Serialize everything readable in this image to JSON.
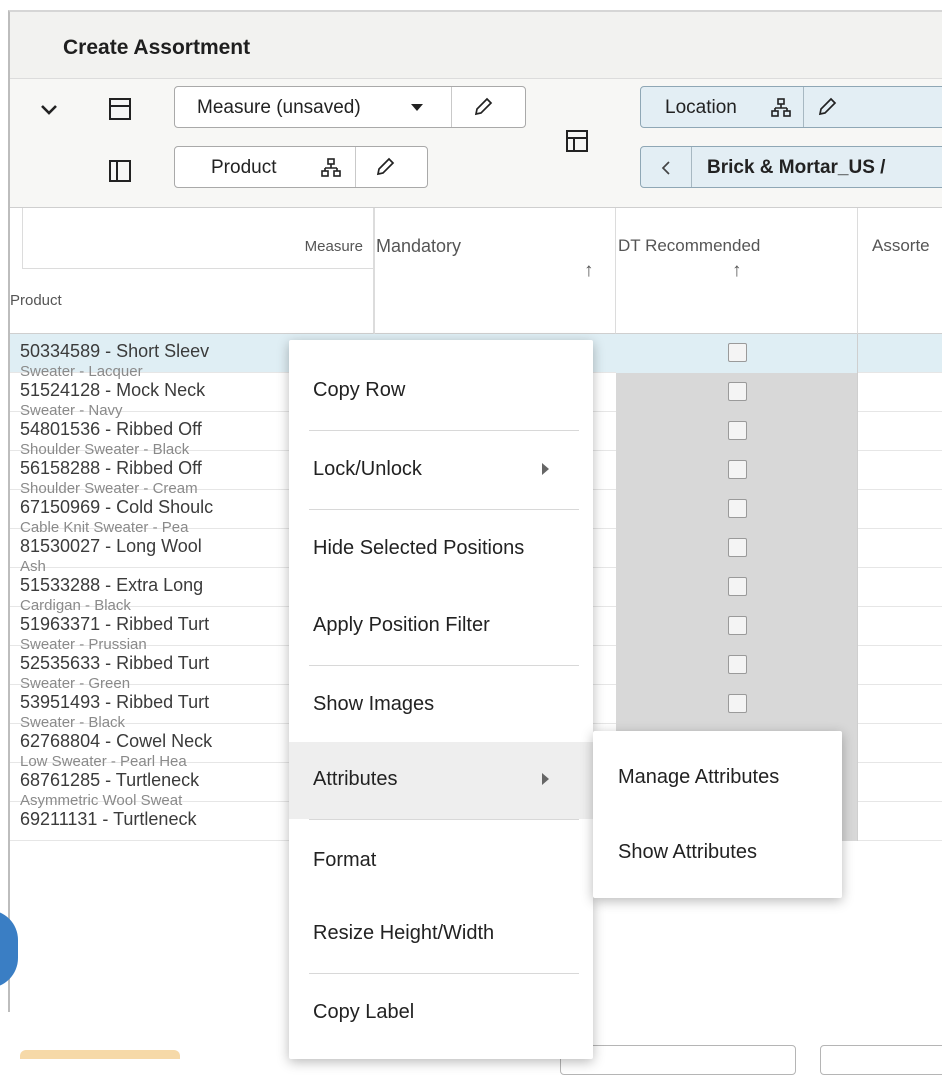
{
  "window": {
    "title": "Create Assortment"
  },
  "toolbar": {
    "measure_label": "Measure (unsaved)",
    "product_label": "Product",
    "location_label": "Location",
    "location_path": "Brick & Mortar_US /"
  },
  "grid": {
    "corner_measure": "Measure",
    "corner_product": "Product",
    "columns": [
      {
        "label": "Mandatory",
        "sort": "↑"
      },
      {
        "label": "DT Recommended",
        "sort": "↑"
      },
      {
        "label": "Assorte"
      }
    ],
    "rows": [
      {
        "product": "50334589 - Short Sleev",
        "sub": "Sweater - Lacquer"
      },
      {
        "product": "51524128 - Mock Neck",
        "sub": "Sweater - Navy"
      },
      {
        "product": "54801536 - Ribbed Off",
        "sub": "Shoulder Sweater - Black"
      },
      {
        "product": "56158288 - Ribbed Off",
        "sub": "Shoulder Sweater - Cream"
      },
      {
        "product": "67150969 - Cold Shoulc",
        "sub": "Cable Knit Sweater - Pea"
      },
      {
        "product": "81530027 - Long Wool",
        "sub": "Ash"
      },
      {
        "product": "51533288 - Extra Long",
        "sub": "Cardigan - Black"
      },
      {
        "product": "51963371 - Ribbed Turt",
        "sub": "Sweater - Prussian"
      },
      {
        "product": "52535633 - Ribbed Turt",
        "sub": "Sweater - Green"
      },
      {
        "product": "53951493 - Ribbed Turt",
        "sub": "Sweater - Black"
      },
      {
        "product": "62768804 - Cowel Neck",
        "sub": "Low Sweater - Pearl Hea"
      },
      {
        "product": "68761285 - Turtleneck",
        "sub": "Asymmetric Wool Sweat"
      },
      {
        "product": "69211131 - Turtleneck",
        "sub": ""
      }
    ]
  },
  "context_menu": {
    "items": [
      {
        "label": "Copy Row"
      },
      {
        "label": "Lock/Unlock",
        "submenu": true
      },
      {
        "label": "Hide Selected Positions"
      },
      {
        "label": "Apply Position Filter"
      },
      {
        "label": "Show Images"
      },
      {
        "label": "Attributes",
        "submenu": true
      },
      {
        "label": "Format"
      },
      {
        "label": "Resize Height/Width"
      },
      {
        "label": "Copy Label"
      }
    ]
  },
  "submenu": {
    "items": [
      {
        "label": "Manage Attributes"
      },
      {
        "label": "Show Attributes"
      }
    ]
  },
  "colors": {
    "selected_row": "#dfeef4",
    "accent_blue": "#3a7ec4",
    "shaded_column": "#d8d8d8"
  }
}
